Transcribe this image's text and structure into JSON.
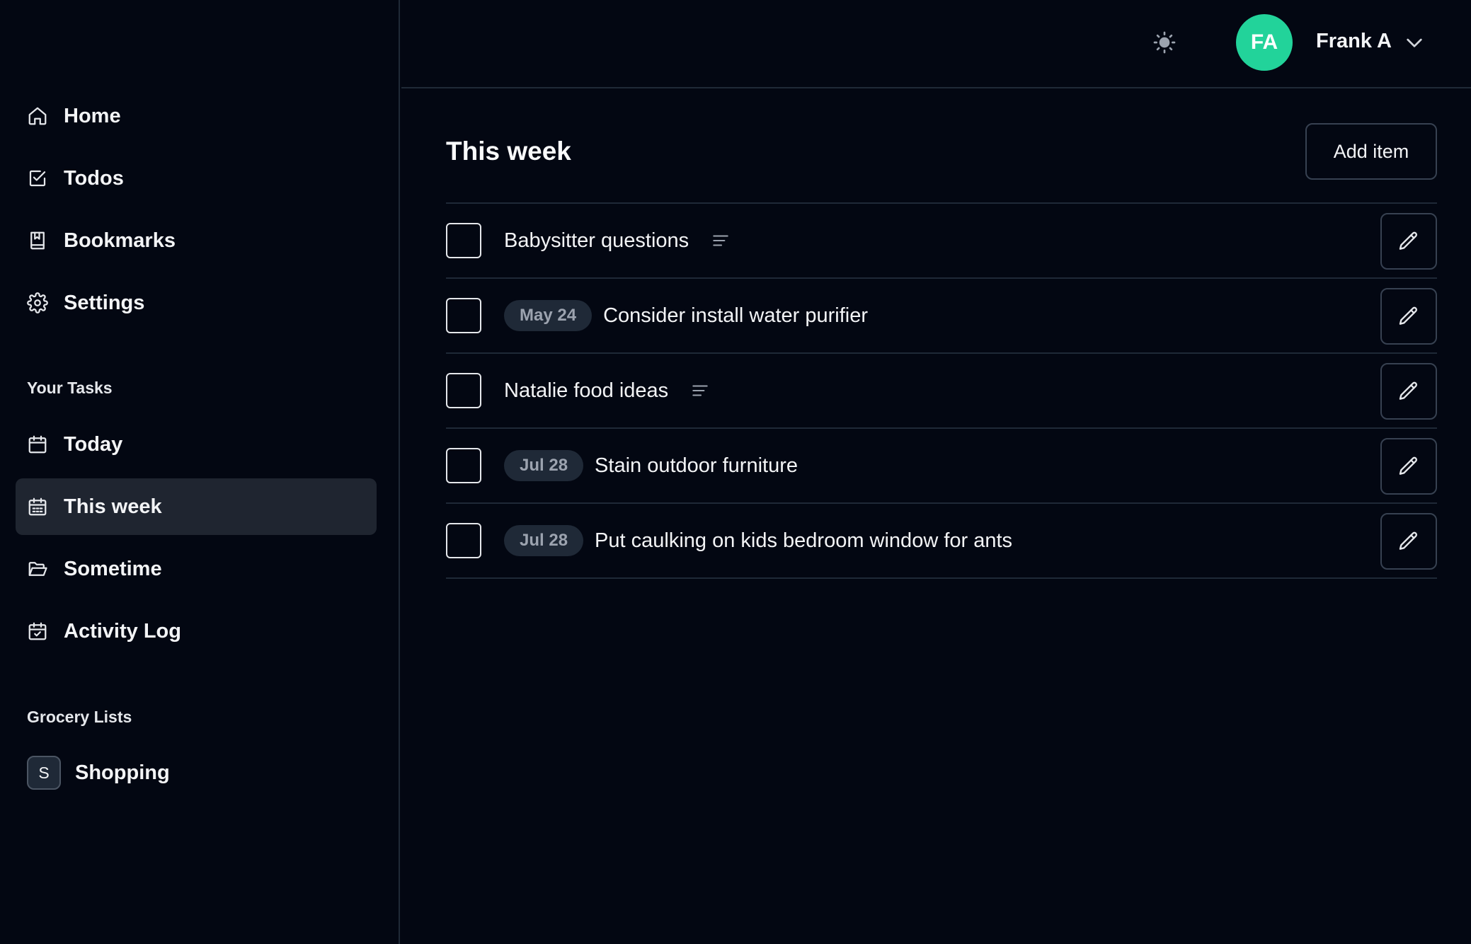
{
  "sidebar": {
    "nav": [
      {
        "label": "Home",
        "icon": "home-icon"
      },
      {
        "label": "Todos",
        "icon": "checkbox-icon"
      },
      {
        "label": "Bookmarks",
        "icon": "bookmark-icon"
      },
      {
        "label": "Settings",
        "icon": "gear-icon"
      }
    ],
    "tasks_heading": "Your Tasks",
    "tasks": [
      {
        "label": "Today",
        "icon": "calendar-icon"
      },
      {
        "label": "This week",
        "icon": "calendar-week-icon",
        "active": true
      },
      {
        "label": "Sometime",
        "icon": "folder-open-icon"
      },
      {
        "label": "Activity Log",
        "icon": "calendar-check-icon"
      }
    ],
    "grocery_heading": "Grocery Lists",
    "grocery": [
      {
        "badge": "S",
        "label": "Shopping"
      }
    ]
  },
  "header": {
    "theme_icon": "sun-icon",
    "avatar_initials": "FA",
    "avatar_color": "#22d39a",
    "user_name": "Frank A"
  },
  "main": {
    "title": "This week",
    "add_label": "Add item",
    "tasks": [
      {
        "date": "",
        "title": "Babysitter questions",
        "has_notes": true
      },
      {
        "date": "May 24",
        "title": "Consider install water purifier",
        "has_notes": false
      },
      {
        "date": "",
        "title": "Natalie food ideas",
        "has_notes": true
      },
      {
        "date": "Jul 28",
        "title": "Stain outdoor furniture",
        "has_notes": false
      },
      {
        "date": "Jul 28",
        "title": "Put caulking on kids bedroom window for ants",
        "has_notes": false
      }
    ]
  }
}
